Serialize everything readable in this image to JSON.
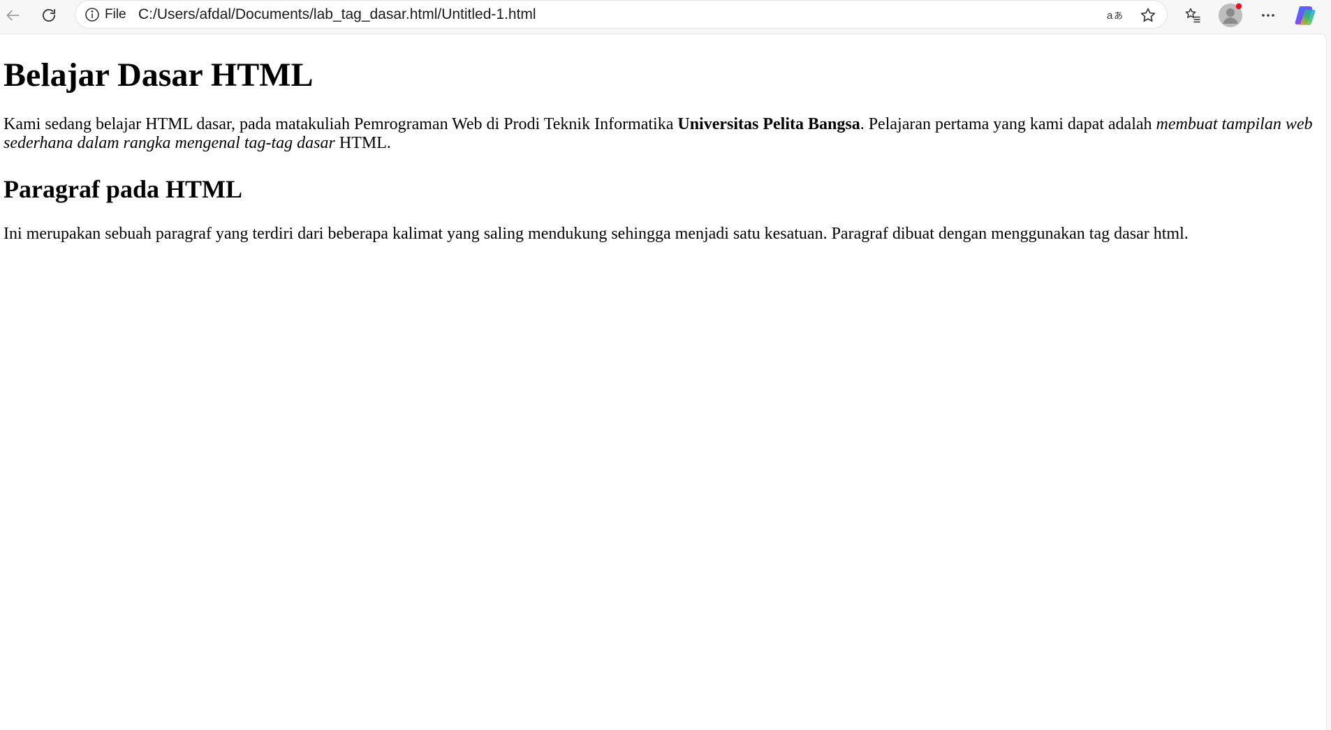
{
  "browser": {
    "scheme_label": "File",
    "url": "C:/Users/afdal/Documents/lab_tag_dasar.html/Untitled-1.html",
    "icons": {
      "back": "back-arrow-icon",
      "refresh": "refresh-icon",
      "info": "info-icon",
      "read_aloud": "read-aloud-icon",
      "favorite": "star-icon",
      "favorites": "favorites-icon",
      "profile": "profile-avatar-icon",
      "more": "more-icon",
      "copilot": "copilot-icon"
    },
    "notification_color": "#e81123"
  },
  "page": {
    "heading1": "Belajar Dasar HTML",
    "paragraph1": {
      "text_a": "Kami sedang belajar HTML dasar, pada matakuliah Pemrograman Web di Prodi Teknik Informatika ",
      "bold": "Universitas Pelita Bangsa",
      "text_b": ". Pelajaran pertama yang kami dapat adalah ",
      "italic": "membuat tampilan web sederhana dalam rangka mengenal tag-tag dasar",
      "text_c": " HTML."
    },
    "heading2": "Paragraf pada HTML",
    "paragraph2": "Ini merupakan sebuah paragraf yang terdiri dari beberapa kalimat yang saling mendukung sehingga menjadi satu kesatuan. Paragraf dibuat dengan menggunakan tag dasar html."
  }
}
